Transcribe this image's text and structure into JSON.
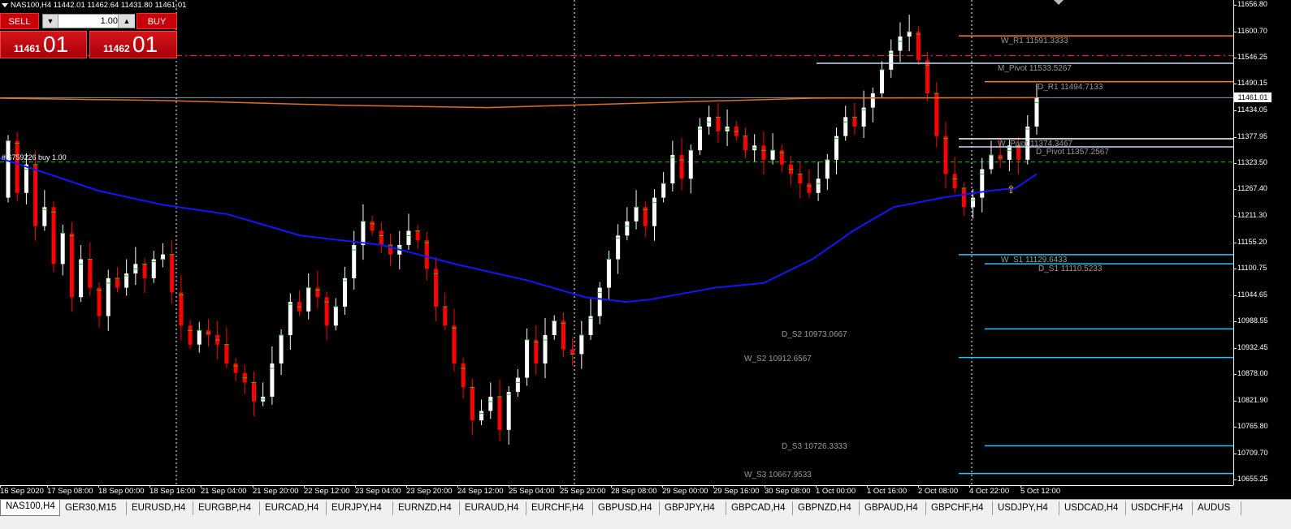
{
  "chart": {
    "symbol_info": "NAS100,H4  11442.01 11462.64 11431.80 11461.01",
    "current_price": "11461.01",
    "order_label": "# 6759226 buy 1.00",
    "price_ticks": [
      "11656.80",
      "11600.70",
      "11546.25",
      "11490.15",
      "11434.05",
      "11377.95",
      "11323.50",
      "11267.40",
      "11211.30",
      "11155.20",
      "11100.75",
      "11044.65",
      "10988.55",
      "10932.45",
      "10878.00",
      "10821.90",
      "10765.80",
      "10709.70",
      "10655.25"
    ],
    "time_ticks": [
      "16 Sep 2020",
      "17 Sep 08:00",
      "18 Sep 00:00",
      "18 Sep 16:00",
      "21 Sep 04:00",
      "21 Sep 20:00",
      "22 Sep 12:00",
      "23 Sep 04:00",
      "23 Sep 20:00",
      "24 Sep 12:00",
      "25 Sep 04:00",
      "25 Sep 20:00",
      "28 Sep 08:00",
      "29 Sep 00:00",
      "29 Sep 16:00",
      "30 Sep 08:00",
      "1 Oct 00:00",
      "1 Oct 16:00",
      "2 Oct 08:00",
      "4 Oct 22:00",
      "5 Oct 12:00"
    ],
    "levels": [
      {
        "name": "W_R1",
        "label": "W_R1 11591.3333",
        "price": 11591.3333,
        "color": "#ff7f27"
      },
      {
        "name": "M_Pivot",
        "label": "M_Pivot 11533.5267",
        "price": 11533.5267,
        "color": "#c8dcff"
      },
      {
        "name": "D_R1",
        "label": "D_R1 11494.7133",
        "price": 11494.7133,
        "color": "#ff7f27"
      },
      {
        "name": "W_Pivot",
        "label": "W_Pivot 11374.3467",
        "price": 11374.3467,
        "color": "#ffffff"
      },
      {
        "name": "D_Pivot",
        "label": "D_Pivot 11357.2567",
        "price": 11357.2567,
        "color": "#c8dcff"
      },
      {
        "name": "W_S1",
        "label": "W_S1 11129.6433",
        "price": 11129.6433,
        "color": "#1ec8ff"
      },
      {
        "name": "D_S1",
        "label": "D_S1 11110.5233",
        "price": 11110.5233,
        "color": "#1ec8ff"
      },
      {
        "name": "D_S2",
        "label": "D_S2 10973.0667",
        "price": 10973.0667,
        "color": "#1ec8ff"
      },
      {
        "name": "W_S2",
        "label": "W_S2 10912.6567",
        "price": 10912.6567,
        "color": "#1ec8ff"
      },
      {
        "name": "D_S3",
        "label": "D_S3 10726.3333",
        "price": 10726.3333,
        "color": "#1ec8ff"
      },
      {
        "name": "W_S3",
        "label": "W_S3 10667.9533",
        "price": 10667.9533,
        "color": "#1ec8ff"
      }
    ],
    "colors": {
      "bull": "#ffffff",
      "bear": "#ff0000",
      "ma": "#1414ff",
      "ma_long": "#e07020",
      "bid_line": "#ff3030",
      "order_line": "#20c020",
      "grid": "#ffffff"
    }
  },
  "trade_panel": {
    "sell_label": "SELL",
    "buy_label": "BUY",
    "lot_value": "1.00",
    "sell_small": "11461",
    "sell_big": "01",
    "buy_small": "11462",
    "buy_big": "01"
  },
  "tabs": [
    "NAS100,H4",
    "GER30,M15",
    "EURUSD,H4",
    "EURGBP,H4",
    "EURCAD,H4",
    "EURJPY,H4",
    "EURNZD,H4",
    "EURAUD,H4",
    "EURCHF,H4",
    "GBPUSD,H4",
    "GBPJPY,H4",
    "GBPCAD,H4",
    "GBPNZD,H4",
    "GBPAUD,H4",
    "GBPCHF,H4",
    "USDJPY,H4",
    "USDCAD,H4",
    "USDCHF,H4",
    "AUDUS"
  ]
}
